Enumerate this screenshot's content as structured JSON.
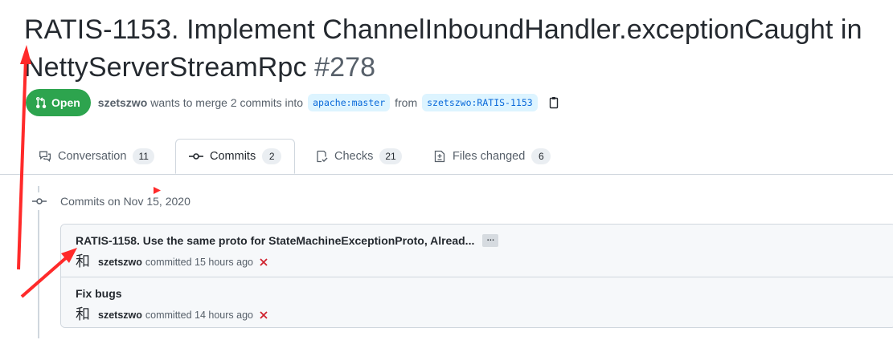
{
  "pr": {
    "title": "RATIS-1153. Implement ChannelInboundHandler.exceptionCaught in NettyServerStreamRpc",
    "number": "#278",
    "state": "Open",
    "author": "szetszwo",
    "merge_text": "wants to merge 2 commits into",
    "base_branch": "apache:master",
    "from_text": "from",
    "head_branch": "szetszwo:RATIS-1153"
  },
  "tabs": [
    {
      "label": "Conversation",
      "count": "11",
      "icon": "comment-discussion-icon"
    },
    {
      "label": "Commits",
      "count": "2",
      "icon": "git-commit-icon"
    },
    {
      "label": "Checks",
      "count": "21",
      "icon": "checklist-icon"
    },
    {
      "label": "Files changed",
      "count": "6",
      "icon": "file-diff-icon"
    }
  ],
  "timeline": {
    "date_label": "Commits on Nov 15, 2020"
  },
  "commits": [
    {
      "message": "RATIS-1158. Use the same proto for StateMachineExceptionProto, Alread...",
      "ellipsis": "…",
      "avatar": "和",
      "author": "szetszwo",
      "time": "committed 15 hours ago",
      "status_icon": "x-icon"
    },
    {
      "message": "Fix bugs",
      "avatar": "和",
      "author": "szetszwo",
      "time": "committed 14 hours ago",
      "status_icon": "x-icon"
    }
  ],
  "colors": {
    "open_green": "#2da44e",
    "link_blue": "#0969da",
    "fail_red": "#cf222e",
    "annotation_red": "#ff2a2a"
  }
}
